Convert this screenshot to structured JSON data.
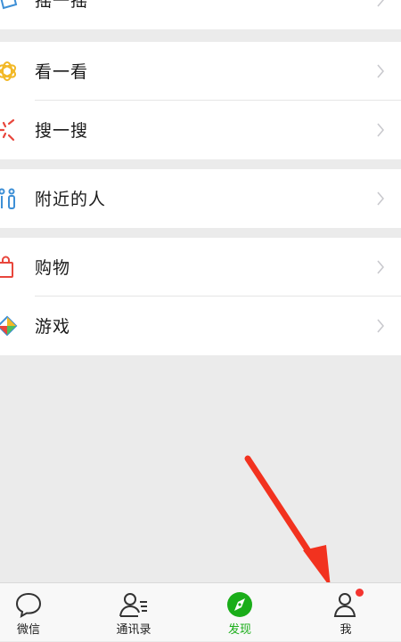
{
  "menu": {
    "shake": {
      "label": "摇一摇"
    },
    "top_stories": {
      "label": "看一看"
    },
    "search": {
      "label": "搜一搜"
    },
    "people_nearby": {
      "label": "附近的人"
    },
    "shopping": {
      "label": "购物"
    },
    "games": {
      "label": "游戏"
    }
  },
  "tabbar": {
    "tabs": [
      {
        "label": "微信",
        "icon": "chat-bubble-icon",
        "active": false
      },
      {
        "label": "通讯录",
        "icon": "contacts-icon",
        "active": false
      },
      {
        "label": "发现",
        "icon": "compass-icon",
        "active": true
      },
      {
        "label": "我",
        "icon": "person-icon",
        "active": false,
        "badge": "dot"
      }
    ]
  },
  "colors": {
    "accent": "#1aad19",
    "badge": "#f43530",
    "arrow": "#f2321f",
    "background": "#ebebeb"
  }
}
